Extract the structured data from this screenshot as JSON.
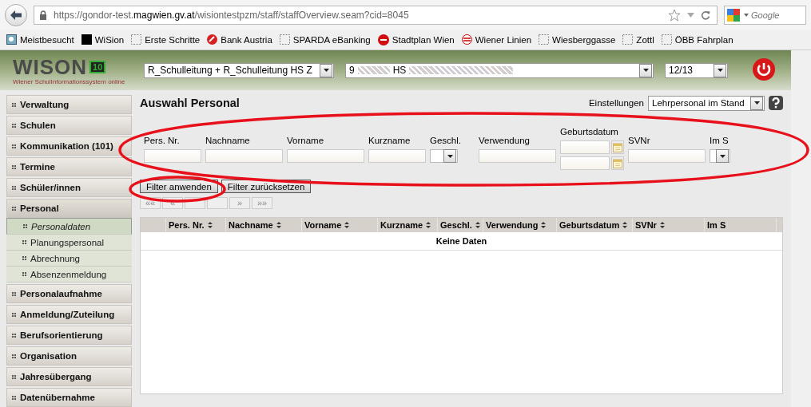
{
  "browser": {
    "url": {
      "prefix": "https://gondor-test.",
      "host": "magwien.gv.at",
      "path": "/wisiontestpzm/staff/staffOverview.seam?cid=8045"
    },
    "search": {
      "placeholder": "Google"
    },
    "bookmarks": [
      {
        "label": "Meistbesucht",
        "kind": "most"
      },
      {
        "label": "WiSion",
        "kind": "black"
      },
      {
        "label": "Erste Schritte",
        "kind": "blank"
      },
      {
        "label": "Bank Austria",
        "kind": "bank"
      },
      {
        "label": "SPARDA eBanking",
        "kind": "blank"
      },
      {
        "label": "Stadtplan Wien",
        "kind": "wien"
      },
      {
        "label": "Wiener Linien",
        "kind": "linien"
      },
      {
        "label": "Wiesberggasse",
        "kind": "blank"
      },
      {
        "label": "Zottl",
        "kind": "blank"
      },
      {
        "label": "ÖBB Fahrplan",
        "kind": "blank"
      }
    ]
  },
  "header": {
    "logo": {
      "text": "WISON",
      "badge": "10",
      "tagline": "Wiener SchulInformationssystem online"
    },
    "role_select": "R_Schulleitung + R_Schulleitung HS Z",
    "school_select": {
      "prefix": "9",
      "middle": "HS"
    },
    "year_select": "12/13"
  },
  "sidebar": {
    "items": [
      {
        "label": "Verwaltung",
        "expanded": false
      },
      {
        "label": "Schulen",
        "expanded": false
      },
      {
        "label": "Kommunikation (101)",
        "expanded": false
      },
      {
        "label": "Termine",
        "expanded": false
      },
      {
        "label": "Schüler/innen",
        "expanded": false
      },
      {
        "label": "Personal",
        "expanded": true,
        "children": [
          {
            "label": "Personaldaten",
            "selected": true
          },
          {
            "label": "Planungspersonal",
            "selected": false
          },
          {
            "label": "Abrechnung",
            "selected": false
          },
          {
            "label": "Absenzenmeldung",
            "selected": false
          }
        ]
      },
      {
        "label": "Personalaufnahme",
        "expanded": false
      },
      {
        "label": "Anmeldung/Zuteilung",
        "expanded": false
      },
      {
        "label": "Berufsorientierung",
        "expanded": false
      },
      {
        "label": "Organisation",
        "expanded": false
      },
      {
        "label": "Jahresübergang",
        "expanded": false
      },
      {
        "label": "Datenübernahme",
        "expanded": false
      }
    ]
  },
  "page": {
    "title": "Auswahl Personal",
    "settings_label": "Einstellungen",
    "settings_value": "Lehrpersonal im Stand"
  },
  "filters": [
    {
      "label": "Pers. Nr.",
      "kind": "text"
    },
    {
      "label": "Nachname",
      "kind": "text"
    },
    {
      "label": "Vorname",
      "kind": "text"
    },
    {
      "label": "Kurzname",
      "kind": "text"
    },
    {
      "label": "Geschl.",
      "kind": "select"
    },
    {
      "label": "Verwendung",
      "kind": "text"
    },
    {
      "label": "Geburtsdatum",
      "kind": "daterange"
    },
    {
      "label": "SVNr",
      "kind": "text"
    },
    {
      "label": "Im S",
      "kind": "select"
    }
  ],
  "buttons": [
    "Filter anwenden",
    "Filter zurücksetzen"
  ],
  "pager": [
    {
      "label": "««",
      "disabled": true
    },
    {
      "label": "«",
      "disabled": true
    },
    {
      "disabled": true
    },
    {
      "disabled": true
    },
    {
      "label": "»",
      "disabled": true
    },
    {
      "label": "»»",
      "disabled": true
    }
  ],
  "table": {
    "columns": [
      "Pers. Nr.",
      "Nachname",
      "Vorname",
      "Kurzname",
      "Geschl.",
      "Verwendung",
      "Geburtsdatum",
      "SVNr",
      "Im S"
    ],
    "empty_message": "Keine Daten"
  },
  "annotations": [
    {
      "kind": "ellipse"
    },
    {
      "kind": "ellipse"
    }
  ]
}
